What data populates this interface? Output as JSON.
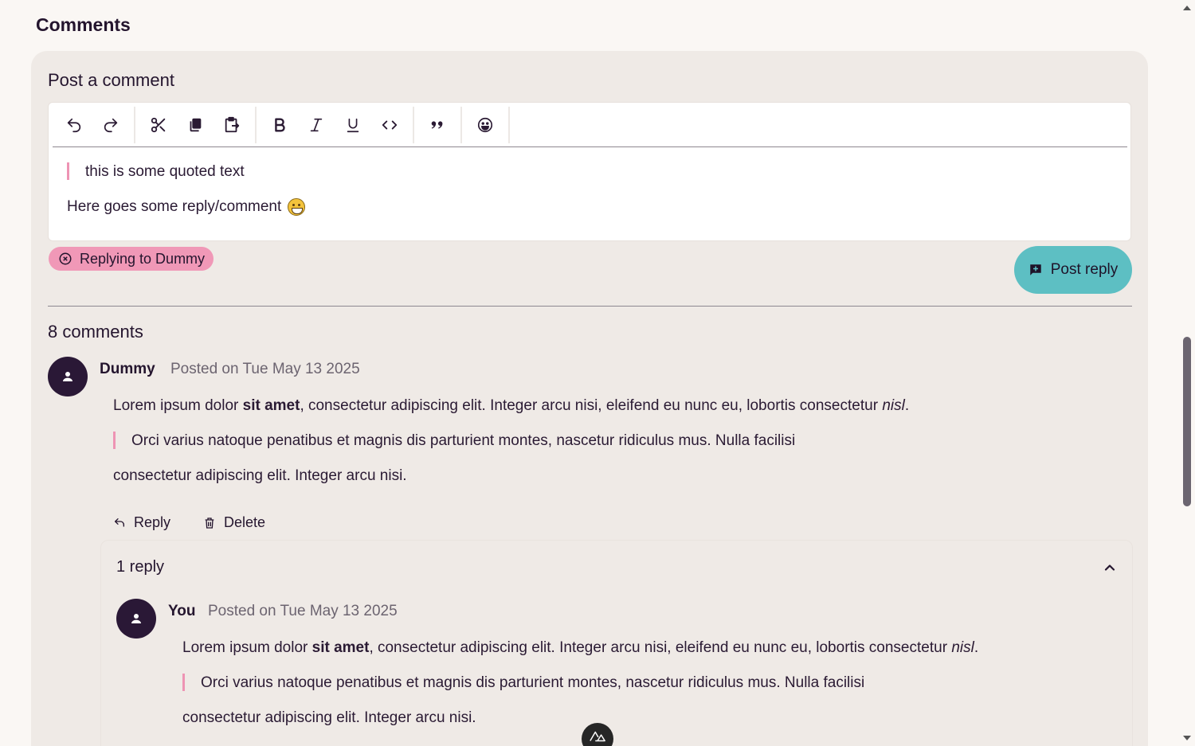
{
  "page": {
    "title": "Comments"
  },
  "composer": {
    "title": "Post a comment",
    "toolbar": {
      "groups": [
        [
          "undo-icon",
          "redo-icon"
        ],
        [
          "cut-icon",
          "copy-icon",
          "paste-icon"
        ],
        [
          "bold-icon",
          "italic-icon",
          "underline-icon",
          "code-icon"
        ],
        [
          "blockquote-icon"
        ],
        [
          "emoji-icon"
        ]
      ]
    },
    "quote": "this is some quoted text",
    "text": "Here goes some reply/comment",
    "replying_to": "Replying to Dummy",
    "post_label": "Post reply"
  },
  "comments_count": "8 comments",
  "comments": [
    {
      "author": "Dummy",
      "date": "Posted on Tue May 13 2025",
      "p1_a": "Lorem ipsum dolor ",
      "p1_b": "sit amet",
      "p1_c": ", consectetur adipiscing elit. Integer arcu nisi, eleifend eu nunc eu, lobortis consectetur ",
      "p1_d": "nisl",
      "p1_e": ".",
      "quote": "Orci varius natoque penatibus et magnis dis parturient montes, nascetur ridiculus mus. Nulla facilisi",
      "p2": "consectetur adipiscing elit. Integer arcu nisi.",
      "reply_label": "Reply",
      "delete_label": "Delete",
      "replies_title": "1 reply"
    },
    {
      "author": "You",
      "date": "Posted on Tue May 13 2025",
      "p1_a": "Lorem ipsum dolor ",
      "p1_b": "sit amet",
      "p1_c": ", consectetur adipiscing elit. Integer arcu nisi, eleifend eu nunc eu, lobortis consectetur ",
      "p1_d": "nisl",
      "p1_e": ".",
      "quote": "Orci varius natoque penatibus et magnis dis parturient montes, nascetur ridiculus mus. Nulla facilisi",
      "p2": "consectetur adipiscing elit. Integer arcu nisi."
    }
  ],
  "colors": {
    "accent_pink": "#f098b7",
    "accent_teal": "#5dbfc3",
    "avatar": "#2a1836"
  }
}
